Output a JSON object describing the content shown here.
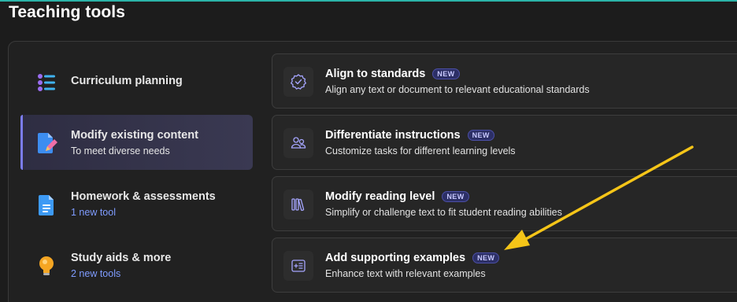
{
  "header": {
    "title": "Teaching tools"
  },
  "sidebar": {
    "items": [
      {
        "title": "Curriculum planning",
        "subtitle": ""
      },
      {
        "title": "Modify existing content",
        "subtitle": "To meet diverse needs"
      },
      {
        "title": "Homework & assessments",
        "subtitle": "1 new tool"
      },
      {
        "title": "Study aids & more",
        "subtitle": "2 new tools"
      }
    ]
  },
  "cards": [
    {
      "title": "Align to standards",
      "badge": "NEW",
      "description": "Align any text or document to relevant educational standards"
    },
    {
      "title": "Differentiate instructions",
      "badge": "NEW",
      "description": "Customize tasks for different learning levels"
    },
    {
      "title": "Modify reading level",
      "badge": "NEW",
      "description": "Simplify or challenge text to fit student reading abilities"
    },
    {
      "title": "Add supporting examples",
      "badge": "NEW",
      "description": "Enhance text with relevant examples"
    }
  ],
  "colors": {
    "accent": "#7b7cf0",
    "link": "#7f9cff",
    "annotation_arrow": "#f5c518",
    "top_bar": "#2bb3a8"
  },
  "icons": {
    "curriculum": "list-icon",
    "modify": "document-edit-icon",
    "homework": "document-icon",
    "study": "lightbulb-icon",
    "align": "badge-check-icon",
    "differentiate": "people-icon",
    "reading": "books-icon",
    "examples": "add-list-icon"
  }
}
